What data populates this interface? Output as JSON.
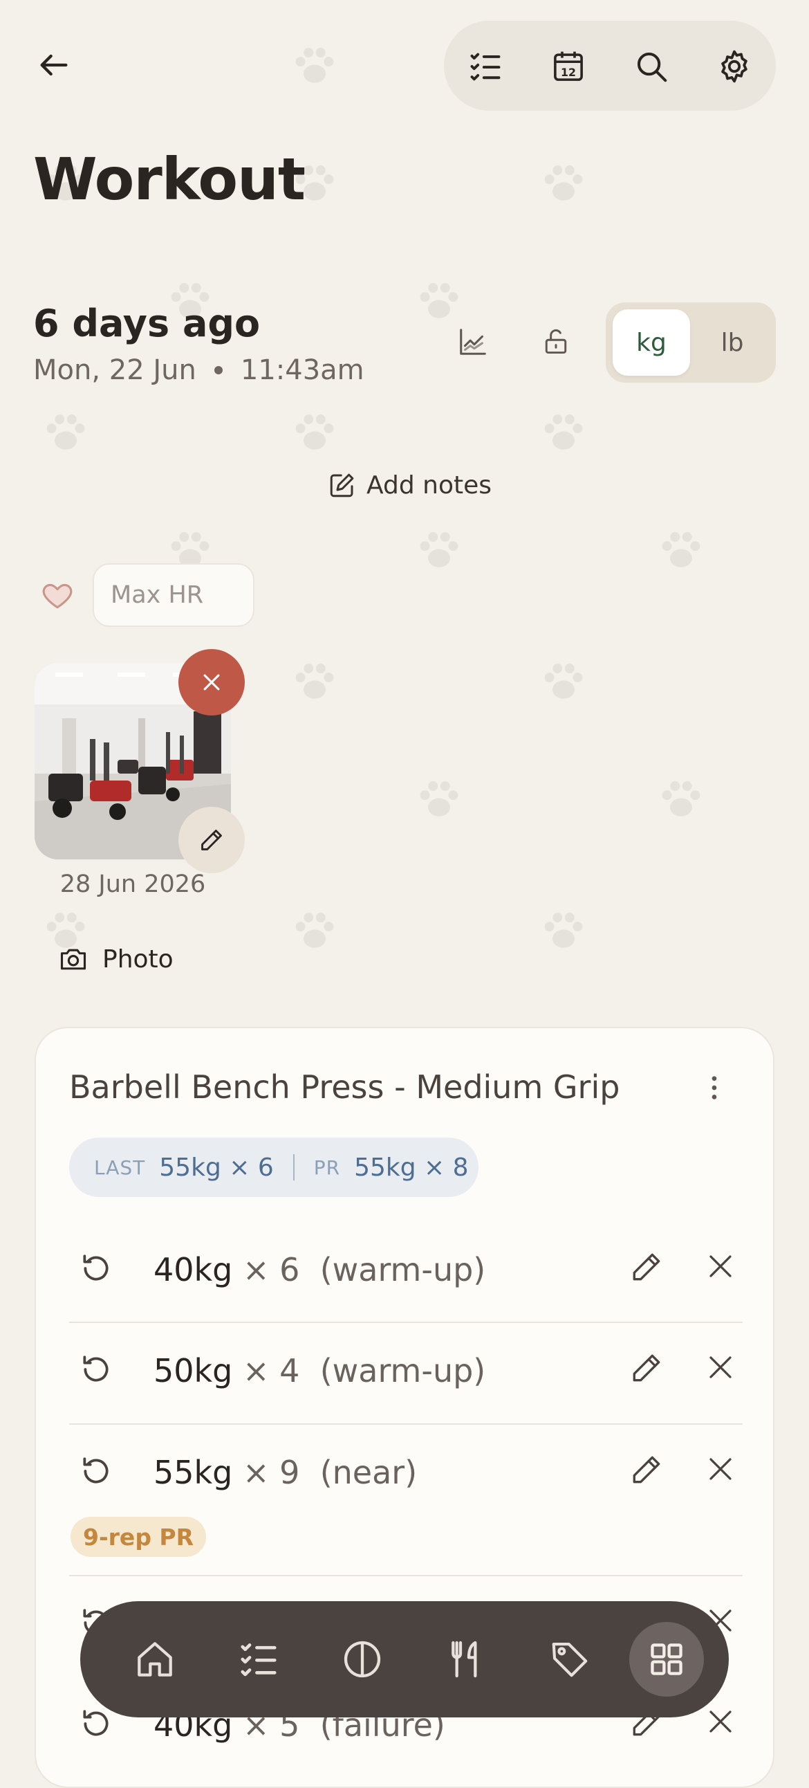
{
  "header": {
    "title": "Workout",
    "icons": [
      "back-arrow-icon",
      "checklist-icon",
      "calendar-icon",
      "search-icon",
      "gear-icon"
    ],
    "calendar_day": "12"
  },
  "session": {
    "relative_time": "6 days ago",
    "date": "Mon, 22 Jun",
    "time": "11:43am",
    "unit_kg": "kg",
    "unit_lb": "lb",
    "selected_unit": "kg"
  },
  "notes": {
    "add_label": "Add notes"
  },
  "heart_rate": {
    "placeholder": "Max HR"
  },
  "photo": {
    "date": "28 Jun 2026",
    "add_label": "Photo"
  },
  "exercise": {
    "name": "Barbell Bench Press - Medium Grip",
    "last_key": "LAST",
    "last_value": "55kg × 6",
    "pr_key": "PR",
    "pr_value": "55kg × 8",
    "sets": [
      {
        "weight": "40kg",
        "reps": "× 6",
        "tag": "(warm-up)"
      },
      {
        "weight": "50kg",
        "reps": "× 4",
        "tag": "(warm-up)"
      },
      {
        "weight": "55kg",
        "reps": "× 9",
        "tag": "(near)"
      },
      {
        "weight": "40kg",
        "reps": "× 5",
        "tag": "(failure)"
      }
    ],
    "pr_badge": "9-rep PR"
  },
  "nav": {
    "items": [
      "home-icon",
      "checklist-icon",
      "half-circle-icon",
      "fork-knife-icon",
      "tag-icon",
      "grid-icon"
    ],
    "active": "grid-icon"
  },
  "colors": {
    "background": "#f4f1ea",
    "accent_green": "#2f5a3c",
    "delete_red": "#c05848",
    "pr_orange": "#c5863e",
    "nav_bg": "#4b4340"
  }
}
